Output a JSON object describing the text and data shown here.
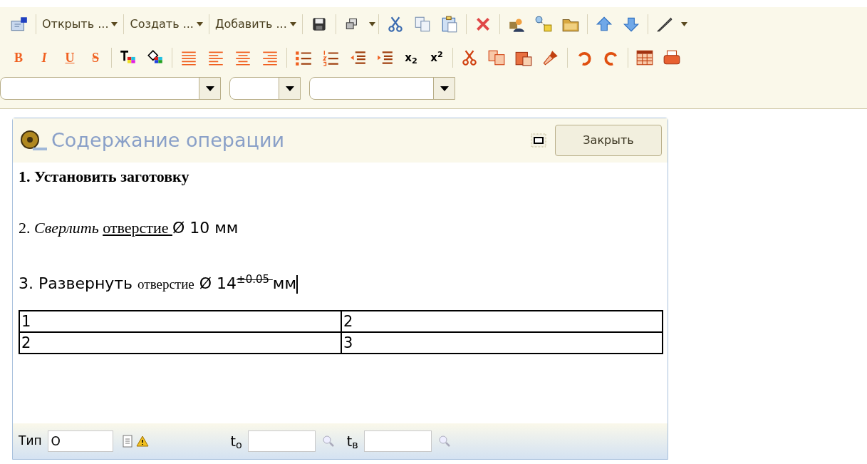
{
  "toolbar": {
    "menu_buttons": [
      "Открыть ...",
      "Создать ...",
      "Добавить ..."
    ],
    "format_buttons": [
      {
        "kind": "bold",
        "label": "B"
      },
      {
        "kind": "italic",
        "label": "I"
      },
      {
        "kind": "underline",
        "label": "U"
      },
      {
        "kind": "strike",
        "label": "S"
      }
    ],
    "script_buttons": [
      "x$_{2}$",
      "x$^{2}$"
    ]
  },
  "panel": {
    "title": "Содержание операции",
    "close_button": "Закрыть",
    "paragraphs": [
      {
        "runs": [
          {
            "kind": "bold-serif",
            "text": "1. Установить заготовку"
          }
        ]
      },
      {
        "runs": [
          {
            "kind": "serif",
            "text": "2. "
          },
          {
            "kind": "italic-serif",
            "text": "Сверлить "
          },
          {
            "kind": "underline-serif",
            "text": "отверстие "
          },
          {
            "kind": "sans",
            "text": "Ø 10 мм"
          }
        ]
      },
      {
        "runs": [
          {
            "kind": "sans",
            "text": "3. Развернуть "
          },
          {
            "kind": "small-serif",
            "text": "отверстие"
          },
          {
            "kind": "sans",
            "text": " Ø 14"
          },
          {
            "kind": "sup-strike",
            "text": "±0.05 "
          },
          {
            "kind": "sans",
            "text": "мм"
          }
        ],
        "cursor": true
      }
    ],
    "table": [
      [
        "1",
        "2"
      ],
      [
        "2",
        "3"
      ]
    ],
    "footer": {
      "type_label": "Тип",
      "type_value": "О",
      "to_label": "t$_{о}$",
      "tv_label": "t$_{в}$"
    }
  }
}
